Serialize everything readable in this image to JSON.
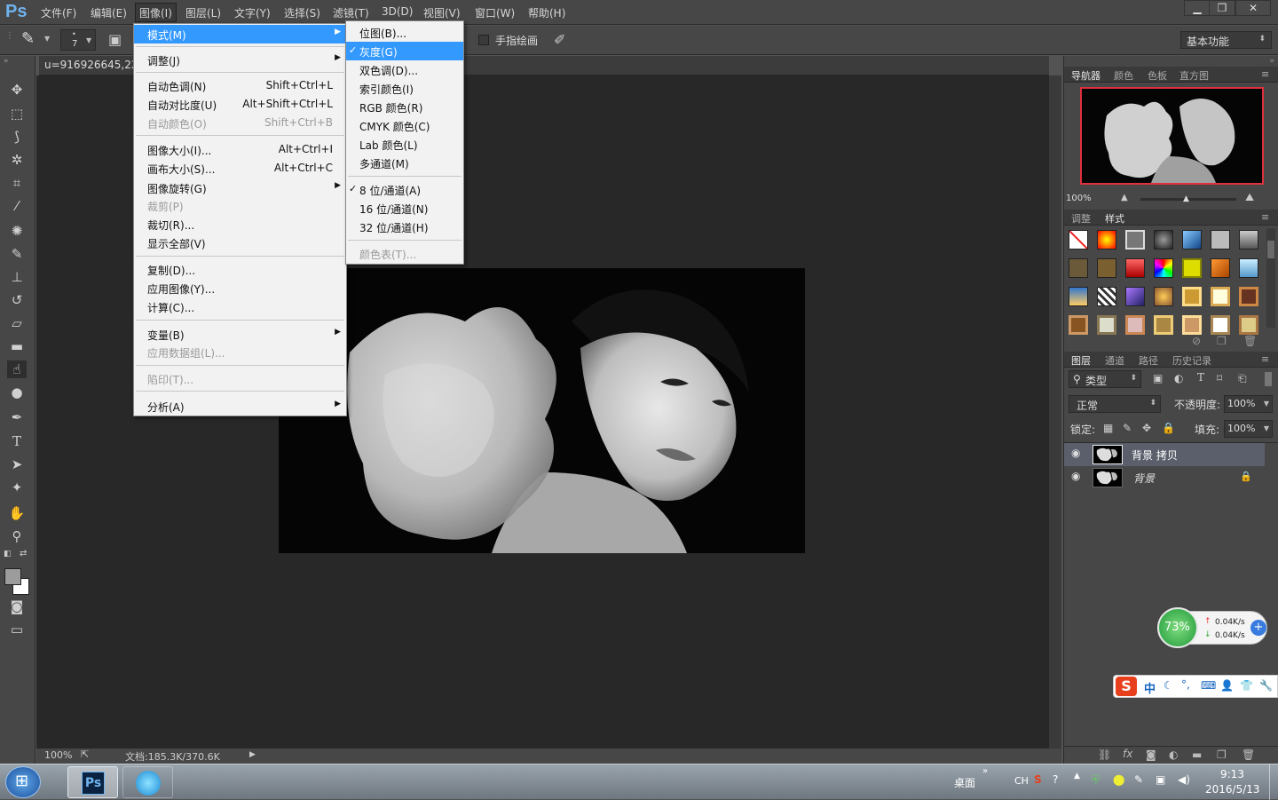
{
  "app": {
    "logo": "Ps"
  },
  "menubar": {
    "items": [
      "文件(F)",
      "编辑(E)",
      "图像(I)",
      "图层(L)",
      "文字(Y)",
      "选择(S)",
      "滤镜(T)",
      "3D(D)",
      "视图(V)",
      "窗口(W)",
      "帮助(H)"
    ]
  },
  "options": {
    "brush_size": "7",
    "finger_paint_label": "手指绘画",
    "workspace": "基本功能"
  },
  "document": {
    "tab_title": "u=916926645,222",
    "zoom": "100%",
    "doc_info": "文档:185.3K/370.6K"
  },
  "image_menu": {
    "items": [
      {
        "label": "模式(M)",
        "shortcut": ""
      },
      {
        "label": "调整(J)",
        "shortcut": ""
      },
      {
        "label": "自动色调(N)",
        "shortcut": "Shift+Ctrl+L"
      },
      {
        "label": "自动对比度(U)",
        "shortcut": "Alt+Shift+Ctrl+L"
      },
      {
        "label": "自动颜色(O)",
        "shortcut": "Shift+Ctrl+B"
      },
      {
        "label": "图像大小(I)...",
        "shortcut": "Alt+Ctrl+I"
      },
      {
        "label": "画布大小(S)...",
        "shortcut": "Alt+Ctrl+C"
      },
      {
        "label": "图像旋转(G)",
        "shortcut": ""
      },
      {
        "label": "裁剪(P)",
        "shortcut": ""
      },
      {
        "label": "裁切(R)...",
        "shortcut": ""
      },
      {
        "label": "显示全部(V)",
        "shortcut": ""
      },
      {
        "label": "复制(D)...",
        "shortcut": ""
      },
      {
        "label": "应用图像(Y)...",
        "shortcut": ""
      },
      {
        "label": "计算(C)...",
        "shortcut": ""
      },
      {
        "label": "变量(B)",
        "shortcut": ""
      },
      {
        "label": "应用数据组(L)...",
        "shortcut": ""
      },
      {
        "label": "陷印(T)...",
        "shortcut": ""
      },
      {
        "label": "分析(A)",
        "shortcut": ""
      }
    ]
  },
  "mode_menu": {
    "items": [
      "位图(B)...",
      "灰度(G)",
      "双色调(D)...",
      "索引颜色(I)",
      "RGB 颜色(R)",
      "CMYK 颜色(C)",
      "Lab 颜色(L)",
      "多通道(M)",
      "8 位/通道(A)",
      "16 位/通道(N)",
      "32 位/通道(H)",
      "颜色表(T)..."
    ]
  },
  "navigator": {
    "tabs": [
      "导航器",
      "颜色",
      "色板",
      "直方图"
    ],
    "zoom": "100%"
  },
  "styles_panel": {
    "tabs": [
      "调整",
      "样式"
    ]
  },
  "layers_panel": {
    "tabs": [
      "图层",
      "通道",
      "路径",
      "历史记录"
    ],
    "filter": "类型",
    "blend_mode": "正常",
    "opacity_label": "不透明度:",
    "opacity": "100%",
    "lock_label": "锁定:",
    "fill_label": "填充:",
    "fill": "100%",
    "layers": [
      {
        "name": "背景 拷贝",
        "selected": true
      },
      {
        "name": "背景",
        "selected": false
      }
    ]
  },
  "speed_widget": {
    "percent": "73%",
    "up": "0.04K/s",
    "down": "0.04K/s"
  },
  "ime_bar": {
    "label": "中"
  },
  "taskbar": {
    "desktop_label": "桌面",
    "lang": "CH",
    "time": "9:13",
    "date": "2016/5/13",
    "ps_label": "Ps"
  },
  "colors": {
    "accent": "#3399ff",
    "ps_blue": "#6fb3ee",
    "selection_red": "#e0303c"
  }
}
